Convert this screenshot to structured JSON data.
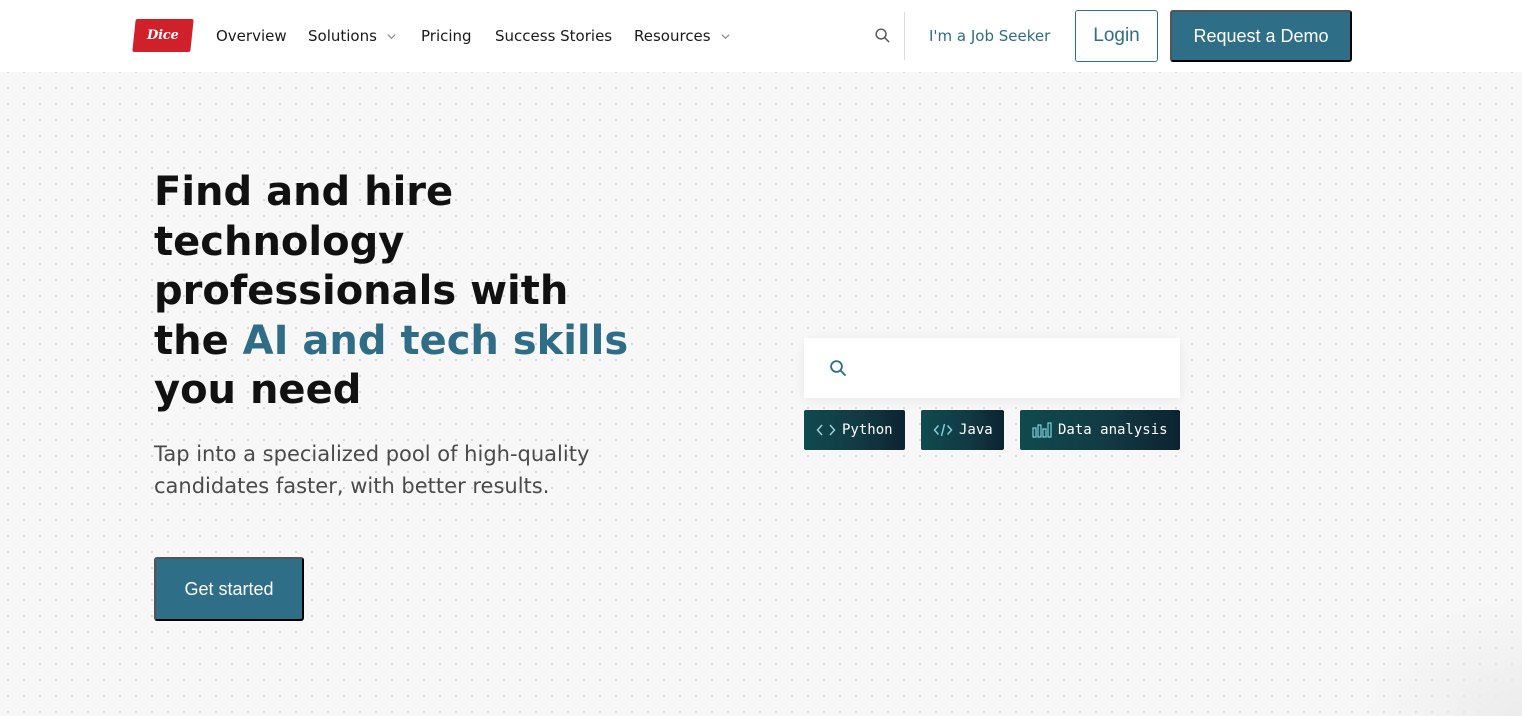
{
  "header": {
    "logo_text": "Dice",
    "nav": [
      {
        "label": "Overview",
        "has_dropdown": false
      },
      {
        "label": "Solutions",
        "has_dropdown": true
      },
      {
        "label": "Pricing",
        "has_dropdown": false
      },
      {
        "label": "Success Stories",
        "has_dropdown": false
      },
      {
        "label": "Resources",
        "has_dropdown": true
      }
    ],
    "job_seeker_label": "I'm a Job Seeker",
    "login_label": "Login",
    "demo_label": "Request a Demo"
  },
  "hero": {
    "title_lines": [
      "Find and hire",
      "technology",
      "professionals with"
    ],
    "title_line4_prefix": "the ",
    "title_line4_accent": "AI and tech skills",
    "title_line5": "you need",
    "subtitle": "Tap into a specialized pool of high-quality candidates faster, with better results.",
    "cta_label": "Get started"
  },
  "search": {
    "placeholder": "",
    "chips": [
      {
        "label": "Python",
        "icon": "code-brackets-icon"
      },
      {
        "label": "Java",
        "icon": "code-slash-icon"
      },
      {
        "label": "Data analysis",
        "icon": "bar-chart-icon"
      }
    ]
  },
  "colors": {
    "accent": "#2e6e86",
    "logo_red": "#d0202a",
    "chip_dark": "#123a44"
  }
}
